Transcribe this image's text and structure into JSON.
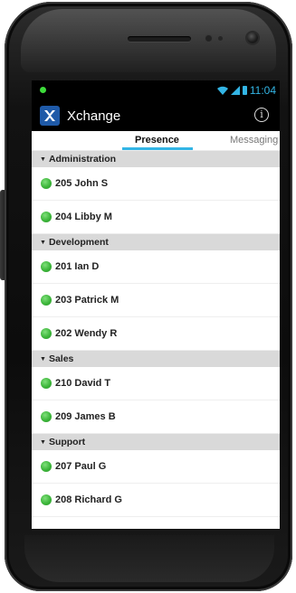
{
  "status_bar": {
    "time": "11:04",
    "icons": [
      "notification-dot-icon",
      "wifi-icon",
      "signal-icon",
      "battery-icon"
    ]
  },
  "action_bar": {
    "app_title": "Xchange",
    "logo_icon": "xchange-logo-icon",
    "info_icon": "info-icon",
    "info_glyph": "i"
  },
  "tabs": [
    {
      "label": "Presence",
      "selected": true
    },
    {
      "label": "Messaging",
      "selected": false
    }
  ],
  "colors": {
    "accent": "#33b5e5",
    "online": "#3cb53a",
    "group_header_bg": "#d9d9d9"
  },
  "groups": [
    {
      "name": "Administration",
      "contacts": [
        {
          "label": "205 John S",
          "status": "online"
        },
        {
          "label": "204 Libby M",
          "status": "online"
        }
      ]
    },
    {
      "name": "Development",
      "contacts": [
        {
          "label": "201 Ian D",
          "status": "online"
        },
        {
          "label": "203 Patrick M",
          "status": "online"
        },
        {
          "label": "202 Wendy R",
          "status": "online"
        }
      ]
    },
    {
      "name": "Sales",
      "contacts": [
        {
          "label": "210 David T",
          "status": "online"
        },
        {
          "label": "209 James B",
          "status": "online"
        }
      ]
    },
    {
      "name": "Support",
      "contacts": [
        {
          "label": "207 Paul G",
          "status": "online"
        },
        {
          "label": "208 Richard G",
          "status": "online"
        }
      ]
    }
  ]
}
